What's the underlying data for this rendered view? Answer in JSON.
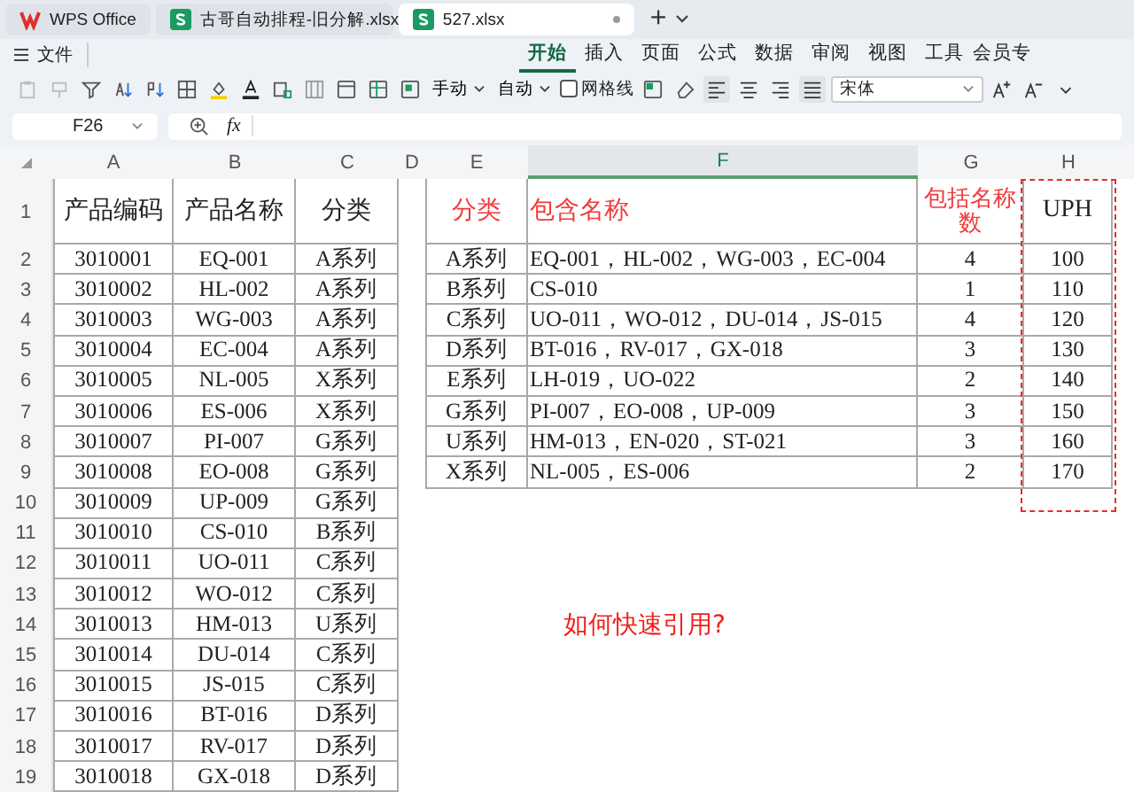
{
  "tabs": [
    {
      "kind": "home",
      "label": "WPS Office",
      "selected": false
    },
    {
      "kind": "doc",
      "label": "古哥自动排程-旧分解.xlsx",
      "selected": false
    },
    {
      "kind": "doc",
      "label": "527.xlsx",
      "selected": true
    }
  ],
  "new_tab": "+",
  "file_menu": "文件",
  "ribbon_tabs": [
    {
      "label": "开始",
      "selected": true
    },
    {
      "label": "插入",
      "selected": false
    },
    {
      "label": "页面",
      "selected": false
    },
    {
      "label": "公式",
      "selected": false
    },
    {
      "label": "数据",
      "selected": false
    },
    {
      "label": "审阅",
      "selected": false
    },
    {
      "label": "视图",
      "selected": false
    },
    {
      "label": "工具",
      "selected": false
    },
    {
      "label": "会员专",
      "selected": false
    }
  ],
  "toolbar": {
    "row_height": "手动",
    "col_width": "自动",
    "gridlines": {
      "label": "网格线",
      "checked": false
    },
    "font": "宋体"
  },
  "name_box": "F26",
  "formula_label": "fx",
  "columns": [
    {
      "label": "A",
      "selected": false
    },
    {
      "label": "B",
      "selected": false
    },
    {
      "label": "C",
      "selected": false
    },
    {
      "label": "D",
      "selected": false
    },
    {
      "label": "E",
      "selected": false
    },
    {
      "label": "F",
      "selected": true
    },
    {
      "label": "G",
      "selected": false
    },
    {
      "label": "H",
      "selected": false
    }
  ],
  "row_numbers": [
    "1",
    "2",
    "3",
    "4",
    "5",
    "6",
    "7",
    "8",
    "9",
    "10",
    "11",
    "12",
    "13",
    "14",
    "15",
    "16",
    "17",
    "18",
    "19"
  ],
  "left_table": {
    "header": [
      "产品编码",
      "产品名称",
      "分类"
    ],
    "rows": [
      [
        "3010001",
        "EQ-001",
        "A系列"
      ],
      [
        "3010002",
        "HL-002",
        "A系列"
      ],
      [
        "3010003",
        "WG-003",
        "A系列"
      ],
      [
        "3010004",
        "EC-004",
        "A系列"
      ],
      [
        "3010005",
        "NL-005",
        "X系列"
      ],
      [
        "3010006",
        "ES-006",
        "X系列"
      ],
      [
        "3010007",
        "PI-007",
        "G系列"
      ],
      [
        "3010008",
        "EO-008",
        "G系列"
      ],
      [
        "3010009",
        "UP-009",
        "G系列"
      ],
      [
        "3010010",
        "CS-010",
        "B系列"
      ],
      [
        "3010011",
        "UO-011",
        "C系列"
      ],
      [
        "3010012",
        "WO-012",
        "C系列"
      ],
      [
        "3010013",
        "HM-013",
        "U系列"
      ],
      [
        "3010014",
        "DU-014",
        "C系列"
      ],
      [
        "3010015",
        "JS-015",
        "C系列"
      ],
      [
        "3010016",
        "BT-016",
        "D系列"
      ],
      [
        "3010017",
        "RV-017",
        "D系列"
      ],
      [
        "3010018",
        "GX-018",
        "D系列"
      ]
    ]
  },
  "right_table": {
    "header": [
      {
        "label": "分类",
        "highlighted": false
      },
      {
        "label": "包含名称",
        "highlighted": false
      },
      {
        "label": "包括名称数",
        "highlighted": false
      },
      {
        "label": "UPH",
        "highlighted": true
      }
    ],
    "rows": [
      [
        "A系列",
        "EQ-001，HL-002，WG-003，EC-004",
        "4",
        "100"
      ],
      [
        "B系列",
        "CS-010",
        "1",
        "110"
      ],
      [
        "C系列",
        "UO-011，WO-012，DU-014，JS-015",
        "4",
        "120"
      ],
      [
        "D系列",
        "BT-016，RV-017，GX-018",
        "3",
        "130"
      ],
      [
        "E系列",
        "LH-019，UO-022",
        "2",
        "140"
      ],
      [
        "G系列",
        "PI-007，EO-008，UP-009",
        "3",
        "150"
      ],
      [
        "U系列",
        "HM-013，EN-020，ST-021",
        "3",
        "160"
      ],
      [
        "X系列",
        "NL-005，ES-006",
        "2",
        "170"
      ]
    ]
  },
  "question": "如何快速引用?"
}
